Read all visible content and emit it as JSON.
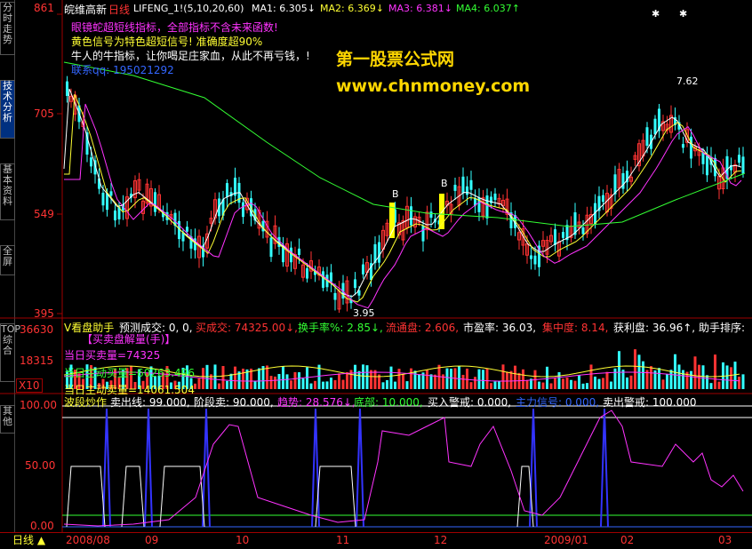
{
  "sidebar": {
    "tabs": [
      {
        "label": "分时走势",
        "active": false
      },
      {
        "label": "技术分析",
        "active": true
      },
      {
        "label": "基本资料",
        "active": false
      },
      {
        "label": "全屏",
        "active": false
      },
      {
        "label": "TOP综合",
        "active": false
      },
      {
        "label": "其他",
        "active": false
      }
    ]
  },
  "main_panel": {
    "stock_name": "皖维高新",
    "period": "日线",
    "indicator": "LIFENG_1!(5,10,20,60)",
    "ma1": "MA1: 6.305↓",
    "ma2": "MA2: 6.369↓",
    "ma3": "MA3: 6.381↓",
    "ma4": "MA4: 6.037↑",
    "text_lines": [
      "眼镜蛇超短线指标，全部指标不含未来函数!",
      "黄色信号为特色超短信号! 准确度超90%",
      "牛人的牛指标，让你喝足庄家血，从此不再亏钱，!",
      "联系qq: 195021292"
    ],
    "watermark_title": "第一股票公式网",
    "watermark_url": "www.chnmoney.com",
    "y_ticks": [
      "861",
      "705",
      "549",
      "395"
    ],
    "high_label": "7.62",
    "low_label": "3.95",
    "b_marks": [
      "B",
      "B"
    ]
  },
  "volume_panel": {
    "header": [
      "V看盘助手",
      "预测成交: 0, 0,",
      "买成交: 74325.00↓,",
      "换手率%: 2.85↓,",
      "流通盘: 2.606,",
      "市盈率: 36.03,",
      "集中度: 8.14,",
      "获利盘: 36.96↑,",
      "助手排序:"
    ],
    "sub_title": "【买卖盘解量(手)】",
    "lines": [
      "当日买卖量=74325",
      "当日主动买量=60263.496",
      "当日主动卖量=14061.504"
    ],
    "y_ticks": [
      "36630",
      "18315",
      "X10"
    ]
  },
  "osc_panel": {
    "header": [
      "波段炒作",
      "卖出线: 99.000,",
      "阶段卖: 90.000,",
      "趋势: 28.576↓,",
      "底部: 10.000,",
      "买入警戒: 0.000,",
      "主力信号: 0.000,",
      "卖出警戒: 100.000"
    ],
    "y_ticks": [
      "100.00",
      "50.00",
      "0.00"
    ]
  },
  "time_axis": [
    "2008/08",
    "09",
    "10",
    "11",
    "12",
    "2009/01",
    "02",
    "03"
  ],
  "bottom": {
    "period_button": "日线"
  },
  "colors": {
    "up": "#ff3333",
    "down": "#33ffff",
    "frame": "#a00000",
    "signal": "#ffff00"
  }
}
